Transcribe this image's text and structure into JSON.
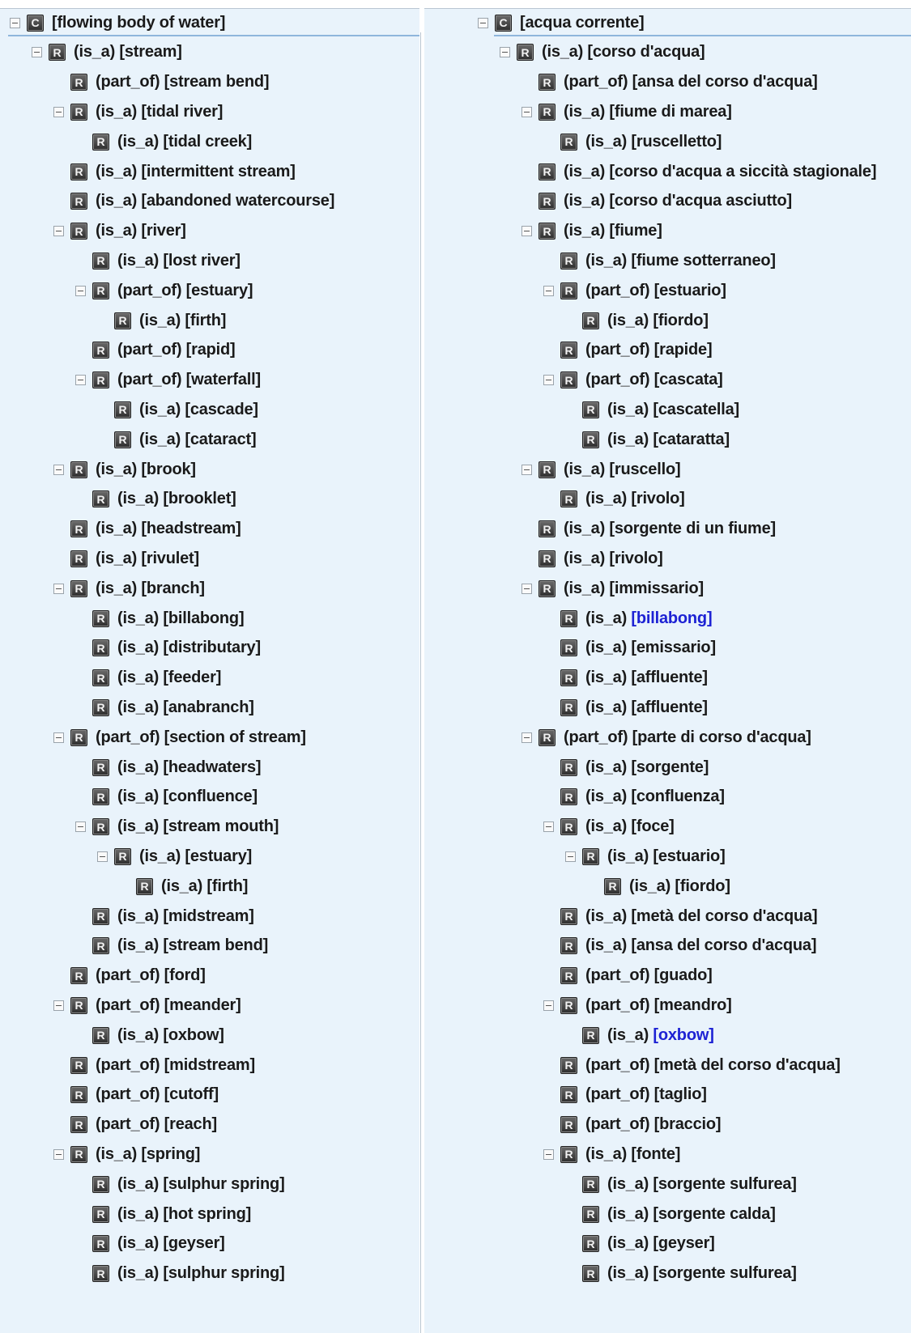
{
  "left_tree": [
    {
      "label": "[flowing body of water]",
      "badge": "C",
      "depth": 0,
      "toggle": true
    },
    {
      "label": "(is_a) [stream]",
      "badge": "R",
      "depth": 1,
      "toggle": true
    },
    {
      "label": "(part_of) [stream bend]",
      "badge": "R",
      "depth": 2,
      "toggle": false
    },
    {
      "label": "(is_a) [tidal river]",
      "badge": "R",
      "depth": 2,
      "toggle": true
    },
    {
      "label": "(is_a) [tidal creek]",
      "badge": "R",
      "depth": 3,
      "toggle": false
    },
    {
      "label": "(is_a) [intermittent stream]",
      "badge": "R",
      "depth": 2,
      "toggle": false
    },
    {
      "label": "(is_a) [abandoned watercourse]",
      "badge": "R",
      "depth": 2,
      "toggle": false
    },
    {
      "label": "(is_a) [river]",
      "badge": "R",
      "depth": 2,
      "toggle": true
    },
    {
      "label": "(is_a) [lost river]",
      "badge": "R",
      "depth": 3,
      "toggle": false
    },
    {
      "label": "(part_of) [estuary]",
      "badge": "R",
      "depth": 3,
      "toggle": true
    },
    {
      "label": "(is_a) [firth]",
      "badge": "R",
      "depth": 4,
      "toggle": false
    },
    {
      "label": "(part_of) [rapid]",
      "badge": "R",
      "depth": 3,
      "toggle": false
    },
    {
      "label": "(part_of) [waterfall]",
      "badge": "R",
      "depth": 3,
      "toggle": true
    },
    {
      "label": "(is_a) [cascade]",
      "badge": "R",
      "depth": 4,
      "toggle": false
    },
    {
      "label": "(is_a) [cataract]",
      "badge": "R",
      "depth": 4,
      "toggle": false
    },
    {
      "label": "(is_a) [brook]",
      "badge": "R",
      "depth": 2,
      "toggle": true
    },
    {
      "label": "(is_a) [brooklet]",
      "badge": "R",
      "depth": 3,
      "toggle": false
    },
    {
      "label": "(is_a) [headstream]",
      "badge": "R",
      "depth": 2,
      "toggle": false
    },
    {
      "label": "(is_a) [rivulet]",
      "badge": "R",
      "depth": 2,
      "toggle": false
    },
    {
      "label": "(is_a) [branch]",
      "badge": "R",
      "depth": 2,
      "toggle": true
    },
    {
      "label": "(is_a) [billabong]",
      "badge": "R",
      "depth": 3,
      "toggle": false
    },
    {
      "label": "(is_a) [distributary]",
      "badge": "R",
      "depth": 3,
      "toggle": false
    },
    {
      "label": "(is_a) [feeder]",
      "badge": "R",
      "depth": 3,
      "toggle": false
    },
    {
      "label": "(is_a) [anabranch]",
      "badge": "R",
      "depth": 3,
      "toggle": false
    },
    {
      "label": "(part_of) [section of stream]",
      "badge": "R",
      "depth": 2,
      "toggle": true
    },
    {
      "label": "(is_a) [headwaters]",
      "badge": "R",
      "depth": 3,
      "toggle": false
    },
    {
      "label": "(is_a) [confluence]",
      "badge": "R",
      "depth": 3,
      "toggle": false
    },
    {
      "label": "(is_a) [stream mouth]",
      "badge": "R",
      "depth": 3,
      "toggle": true
    },
    {
      "label": "(is_a) [estuary]",
      "badge": "R",
      "depth": 4,
      "toggle": true
    },
    {
      "label": "(is_a) [firth]",
      "badge": "R",
      "depth": 5,
      "toggle": false
    },
    {
      "label": "(is_a) [midstream]",
      "badge": "R",
      "depth": 3,
      "toggle": false
    },
    {
      "label": "(is_a) [stream bend]",
      "badge": "R",
      "depth": 3,
      "toggle": false
    },
    {
      "label": "(part_of) [ford]",
      "badge": "R",
      "depth": 2,
      "toggle": false
    },
    {
      "label": "(part_of) [meander]",
      "badge": "R",
      "depth": 2,
      "toggle": true
    },
    {
      "label": "(is_a) [oxbow]",
      "badge": "R",
      "depth": 3,
      "toggle": false
    },
    {
      "label": "(part_of) [midstream]",
      "badge": "R",
      "depth": 2,
      "toggle": false
    },
    {
      "label": "(part_of) [cutoff]",
      "badge": "R",
      "depth": 2,
      "toggle": false
    },
    {
      "label": "(part_of) [reach]",
      "badge": "R",
      "depth": 2,
      "toggle": false
    },
    {
      "label": "(is_a) [spring]",
      "badge": "R",
      "depth": 2,
      "toggle": true
    },
    {
      "label": "(is_a) [sulphur spring]",
      "badge": "R",
      "depth": 3,
      "toggle": false
    },
    {
      "label": "(is_a) [hot spring]",
      "badge": "R",
      "depth": 3,
      "toggle": false
    },
    {
      "label": "(is_a) [geyser]",
      "badge": "R",
      "depth": 3,
      "toggle": false
    },
    {
      "label": "(is_a) [sulphur spring]",
      "badge": "R",
      "depth": 3,
      "toggle": false
    }
  ],
  "right_tree": [
    {
      "label": "[acqua corrente]",
      "badge": "C",
      "depth": 0,
      "toggle": true
    },
    {
      "label": "(is_a) [corso d'acqua]",
      "badge": "R",
      "depth": 1,
      "toggle": true
    },
    {
      "label": "(part_of) [ansa del corso d'acqua]",
      "badge": "R",
      "depth": 2,
      "toggle": false
    },
    {
      "label": "(is_a) [fiume di marea]",
      "badge": "R",
      "depth": 2,
      "toggle": true
    },
    {
      "label": "(is_a) [ruscelletto]",
      "badge": "R",
      "depth": 3,
      "toggle": false
    },
    {
      "label": "(is_a) [corso d'acqua a siccità stagionale]",
      "badge": "R",
      "depth": 2,
      "toggle": false
    },
    {
      "label": "(is_a) [corso d'acqua asciutto]",
      "badge": "R",
      "depth": 2,
      "toggle": false
    },
    {
      "label": "(is_a) [fiume]",
      "badge": "R",
      "depth": 2,
      "toggle": true
    },
    {
      "label": "(is_a) [fiume sotterraneo]",
      "badge": "R",
      "depth": 3,
      "toggle": false
    },
    {
      "label": "(part_of) [estuario]",
      "badge": "R",
      "depth": 3,
      "toggle": true
    },
    {
      "label": "(is_a) [fiordo]",
      "badge": "R",
      "depth": 4,
      "toggle": false
    },
    {
      "label": "(part_of) [rapide]",
      "badge": "R",
      "depth": 3,
      "toggle": false
    },
    {
      "label": "(part_of) [cascata]",
      "badge": "R",
      "depth": 3,
      "toggle": true
    },
    {
      "label": "(is_a) [cascatella]",
      "badge": "R",
      "depth": 4,
      "toggle": false
    },
    {
      "label": "(is_a) [cataratta]",
      "badge": "R",
      "depth": 4,
      "toggle": false
    },
    {
      "label": "(is_a) [ruscello]",
      "badge": "R",
      "depth": 2,
      "toggle": true
    },
    {
      "label": "(is_a) [rivolo]",
      "badge": "R",
      "depth": 3,
      "toggle": false
    },
    {
      "label": "(is_a) [sorgente di un fiume]",
      "badge": "R",
      "depth": 2,
      "toggle": false
    },
    {
      "label": "(is_a) [rivolo]",
      "badge": "R",
      "depth": 2,
      "toggle": false
    },
    {
      "label": "(is_a) [immissario]",
      "badge": "R",
      "depth": 2,
      "toggle": true
    },
    {
      "label": "(is_a) ",
      "link": "[billabong]",
      "badge": "R",
      "depth": 3,
      "toggle": false
    },
    {
      "label": "(is_a) [emissario]",
      "badge": "R",
      "depth": 3,
      "toggle": false
    },
    {
      "label": "(is_a) [affluente]",
      "badge": "R",
      "depth": 3,
      "toggle": false
    },
    {
      "label": "(is_a) [affluente]",
      "badge": "R",
      "depth": 3,
      "toggle": false
    },
    {
      "label": "(part_of) [parte di corso d'acqua]",
      "badge": "R",
      "depth": 2,
      "toggle": true
    },
    {
      "label": "(is_a) [sorgente]",
      "badge": "R",
      "depth": 3,
      "toggle": false
    },
    {
      "label": "(is_a) [confluenza]",
      "badge": "R",
      "depth": 3,
      "toggle": false
    },
    {
      "label": "(is_a) [foce]",
      "badge": "R",
      "depth": 3,
      "toggle": true
    },
    {
      "label": "(is_a) [estuario]",
      "badge": "R",
      "depth": 4,
      "toggle": true
    },
    {
      "label": "(is_a) [fiordo]",
      "badge": "R",
      "depth": 5,
      "toggle": false
    },
    {
      "label": "(is_a) [metà del corso d'acqua]",
      "badge": "R",
      "depth": 3,
      "toggle": false
    },
    {
      "label": "(is_a) [ansa del corso d'acqua]",
      "badge": "R",
      "depth": 3,
      "toggle": false
    },
    {
      "label": "(part_of) [guado]",
      "badge": "R",
      "depth": 3,
      "toggle": false
    },
    {
      "label": "(part_of) [meandro]",
      "badge": "R",
      "depth": 3,
      "toggle": true
    },
    {
      "label": "(is_a) ",
      "link": "[oxbow]",
      "badge": "R",
      "depth": 4,
      "toggle": false
    },
    {
      "label": "(part_of) [metà del corso d'acqua]",
      "badge": "R",
      "depth": 3,
      "toggle": false
    },
    {
      "label": "(part_of) [taglio]",
      "badge": "R",
      "depth": 3,
      "toggle": false
    },
    {
      "label": "(part_of) [braccio]",
      "badge": "R",
      "depth": 3,
      "toggle": false
    },
    {
      "label": "(is_a) [fonte]",
      "badge": "R",
      "depth": 3,
      "toggle": true
    },
    {
      "label": "(is_a) [sorgente sulfurea]",
      "badge": "R",
      "depth": 4,
      "toggle": false
    },
    {
      "label": "(is_a) [sorgente calda]",
      "badge": "R",
      "depth": 4,
      "toggle": false
    },
    {
      "label": "(is_a) [geyser]",
      "badge": "R",
      "depth": 4,
      "toggle": false
    },
    {
      "label": "(is_a) [sorgente sulfurea]",
      "badge": "R",
      "depth": 4,
      "toggle": false
    }
  ],
  "colors": {
    "panel_bg": "#e9f3fb",
    "link": "#1d22d4",
    "badge_bg": "#3a3a3a"
  }
}
